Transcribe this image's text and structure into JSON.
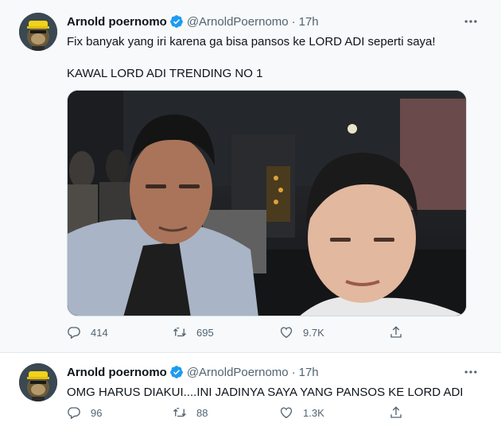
{
  "tweets": [
    {
      "author_name": "Arnold poernomo",
      "handle": "@ArnoldPoernomo",
      "separator": "·",
      "time": "17h",
      "lines": [
        "Fix banyak yang iri karena ga bisa pansos ke LORD ADI seperti saya!",
        "KAWAL LORD ADI TRENDING NO 1"
      ],
      "has_photo": true,
      "stats": {
        "replies": "414",
        "retweets": "695",
        "likes": "9.7K"
      }
    },
    {
      "author_name": "Arnold poernomo",
      "handle": "@ArnoldPoernomo",
      "separator": "·",
      "time": "17h",
      "lines": [
        "OMG HARUS DIAKUI....INI JADINYA SAYA YANG PANSOS KE LORD ADI"
      ],
      "has_photo": false,
      "stats": {
        "replies": "96",
        "retweets": "88",
        "likes": "1.3K"
      }
    }
  ],
  "icons": {
    "verified": "verified-badge-icon",
    "more": "more-options-icon",
    "reply": "reply-icon",
    "retweet": "retweet-icon",
    "like": "like-icon",
    "share": "share-icon"
  },
  "colors": {
    "verified_blue": "#1d9bf0",
    "secondary_text": "#536471",
    "primary_text": "#0f1419",
    "first_tweet_bg": "#f7f9fa"
  }
}
